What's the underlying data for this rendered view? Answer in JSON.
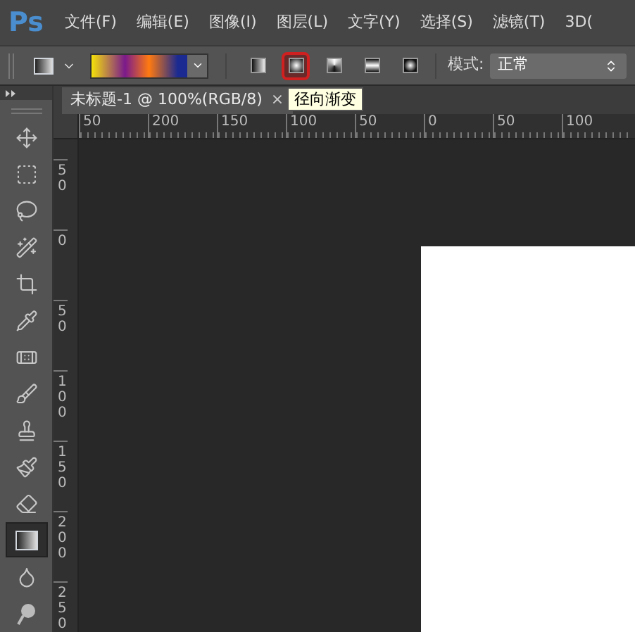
{
  "menu": {
    "logo": "Ps",
    "items": [
      "文件(F)",
      "编辑(E)",
      "图像(I)",
      "图层(L)",
      "文字(Y)",
      "选择(S)",
      "滤镜(T)",
      "3D("
    ]
  },
  "options": {
    "gradient_types": [
      {
        "kind": "linear",
        "selected": false
      },
      {
        "kind": "radial",
        "selected": true
      },
      {
        "kind": "angle",
        "selected": false
      },
      {
        "kind": "reflected",
        "selected": false
      },
      {
        "kind": "diamond",
        "selected": false
      }
    ],
    "mode_label": "模式:",
    "mode_value": "正常"
  },
  "document_tab": {
    "title": "未标题-1 @ 100%(RGB/8)",
    "close": "×"
  },
  "tooltip": "径向渐变",
  "horizontal_ruler": [
    "50",
    "200",
    "150",
    "100",
    "50",
    "0",
    "50",
    "100"
  ],
  "vertical_ruler": [
    "50",
    "0",
    "50",
    "100",
    "150",
    "200",
    "250"
  ],
  "tools": [
    {
      "kind": "move",
      "selected": false
    },
    {
      "kind": "marquee",
      "selected": false
    },
    {
      "kind": "lasso",
      "selected": false
    },
    {
      "kind": "quick-select",
      "selected": false
    },
    {
      "kind": "crop",
      "selected": false
    },
    {
      "kind": "eyedropper",
      "selected": false
    },
    {
      "kind": "healing",
      "selected": false
    },
    {
      "kind": "brush",
      "selected": false
    },
    {
      "kind": "stamp",
      "selected": false
    },
    {
      "kind": "history-brush",
      "selected": false
    },
    {
      "kind": "eraser",
      "selected": false
    },
    {
      "kind": "gradient",
      "selected": true
    },
    {
      "kind": "blur",
      "selected": false
    },
    {
      "kind": "dodge",
      "selected": false
    }
  ]
}
